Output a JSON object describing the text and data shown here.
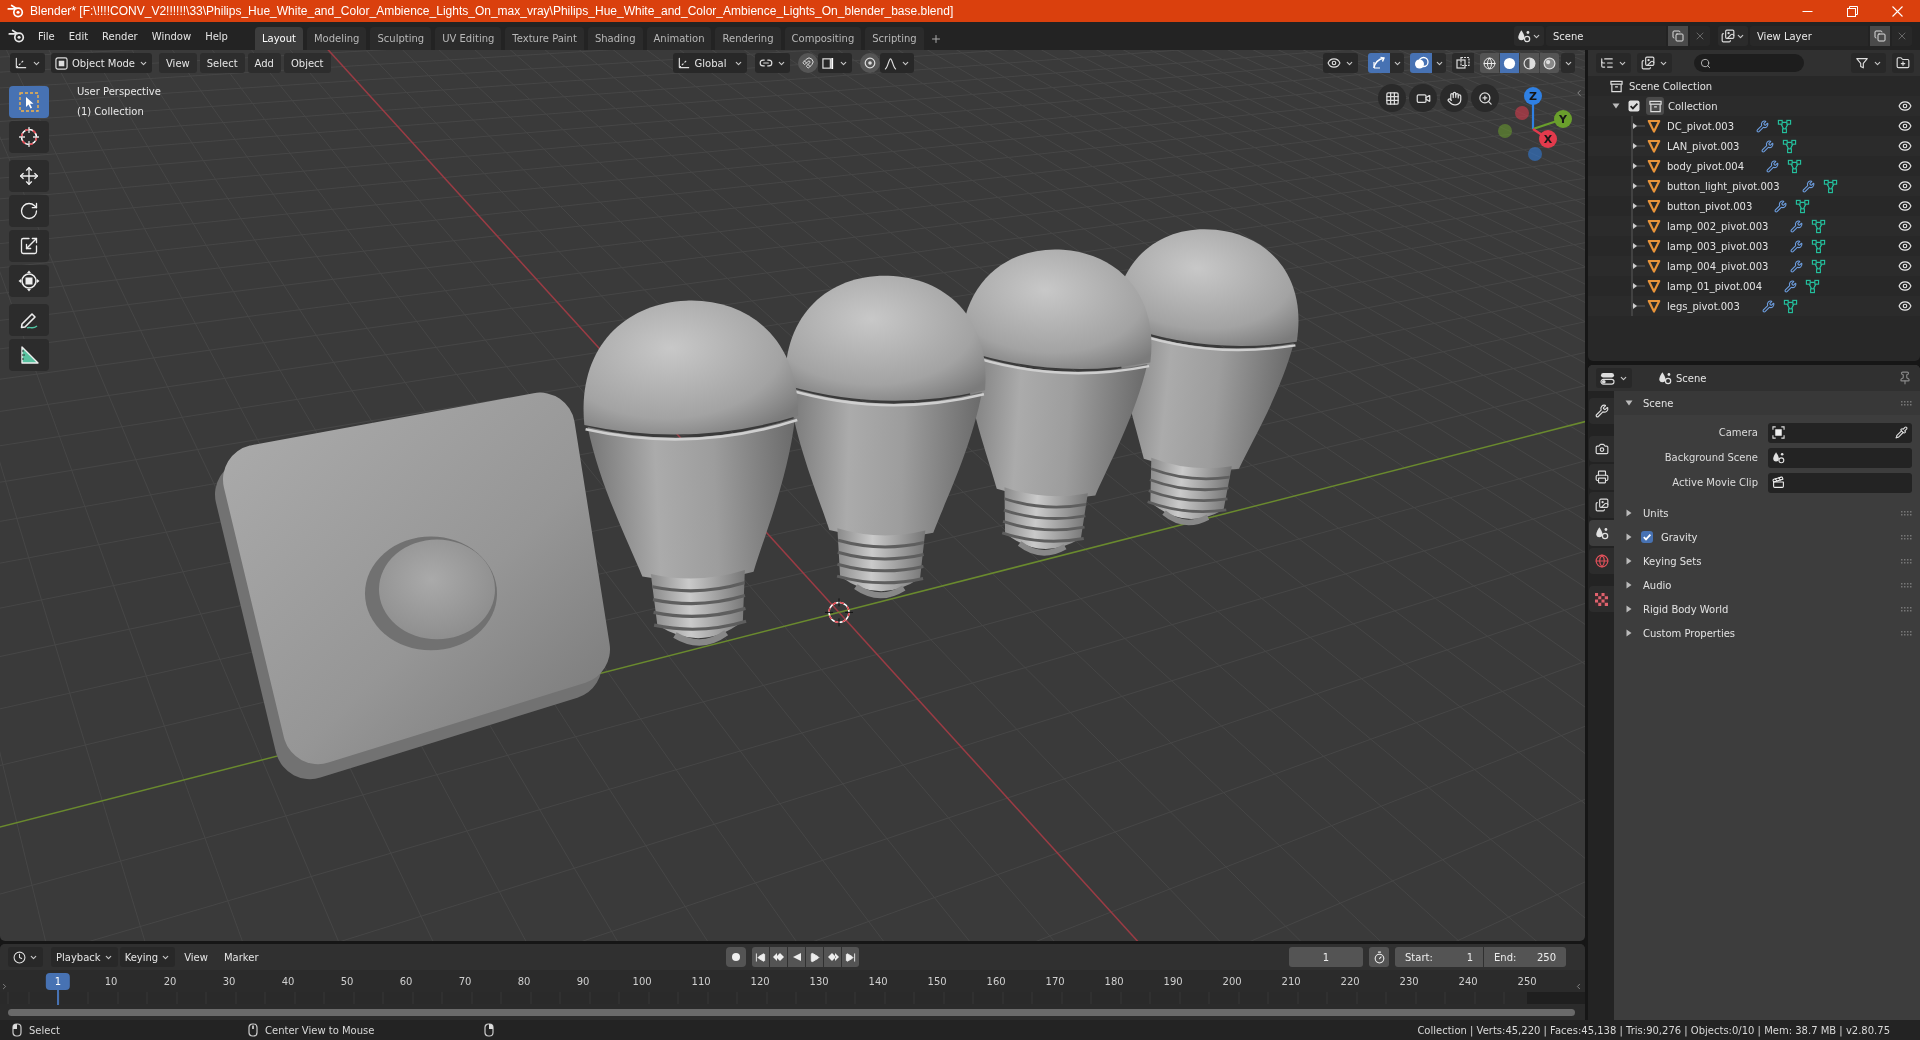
{
  "window": {
    "title": "Blender* [F:\\!!!!CONV_V2!!!!!!\\33\\Philips_Hue_White_and_Color_Ambience_Lights_On_max_vray\\Philips_Hue_White_and_Color_Ambience_Lights_On_blender_base.blend]"
  },
  "menu": [
    "File",
    "Edit",
    "Render",
    "Window",
    "Help"
  ],
  "workspaces": [
    {
      "label": "Layout",
      "selected": true
    },
    {
      "label": "Modeling",
      "selected": false
    },
    {
      "label": "Sculpting",
      "selected": false
    },
    {
      "label": "UV Editing",
      "selected": false
    },
    {
      "label": "Texture Paint",
      "selected": false
    },
    {
      "label": "Shading",
      "selected": false
    },
    {
      "label": "Animation",
      "selected": false
    },
    {
      "label": "Rendering",
      "selected": false
    },
    {
      "label": "Compositing",
      "selected": false
    },
    {
      "label": "Scripting",
      "selected": false
    }
  ],
  "scene": "Scene",
  "view_layer": "View Layer",
  "viewport": {
    "mode": "Object Mode",
    "menus": [
      "View",
      "Select",
      "Add",
      "Object"
    ],
    "orientation": "Global",
    "snap": false,
    "proportional_editing": false,
    "toggles": [
      {
        "kind": "gizmos",
        "on": true
      },
      {
        "kind": "overlays",
        "on": true
      },
      {
        "kind": "xray",
        "on": false
      }
    ],
    "shading": [
      {
        "kind": "wireframe",
        "selected": false
      },
      {
        "kind": "solid",
        "selected": true
      },
      {
        "kind": "material",
        "selected": false
      },
      {
        "kind": "rendered",
        "selected": false
      }
    ],
    "info": [
      "User Perspective",
      "(1) Collection"
    ],
    "tools": [
      [
        {
          "kind": "select_box",
          "selected": true
        },
        {
          "kind": "cursor",
          "selected": false
        }
      ],
      [
        {
          "kind": "move",
          "selected": false
        },
        {
          "kind": "rotate",
          "selected": false
        },
        {
          "kind": "scale",
          "selected": false
        },
        {
          "kind": "transform",
          "selected": false
        }
      ],
      [
        {
          "kind": "annotate",
          "selected": false
        },
        {
          "kind": "measure",
          "selected": false
        }
      ]
    ],
    "gizmo": [
      {
        "label": "Z",
        "color": "#2f80e3"
      },
      {
        "label": "Y",
        "color": "#6a9f2c"
      },
      {
        "label": "X",
        "color": "#e23a4c"
      }
    ]
  },
  "outliner": {
    "root": "Scene Collection",
    "items": [
      {
        "kind": "collection",
        "name": "Collection",
        "checked": true,
        "active": true,
        "expanded": true,
        "visible": true,
        "children": [
          {
            "kind": "mesh",
            "name": "DC_pivot.003",
            "expanded": false,
            "visible": true
          },
          {
            "kind": "mesh",
            "name": "LAN_pivot.003",
            "expanded": false,
            "visible": true
          },
          {
            "kind": "mesh",
            "name": "body_pivot.004",
            "expanded": false,
            "visible": true
          },
          {
            "kind": "mesh",
            "name": "button_light_pivot.003",
            "expanded": false,
            "visible": true
          },
          {
            "kind": "mesh",
            "name": "button_pivot.003",
            "expanded": false,
            "visible": true
          },
          {
            "kind": "mesh",
            "name": "lamp_002_pivot.003",
            "expanded": false,
            "visible": true
          },
          {
            "kind": "mesh",
            "name": "lamp_003_pivot.003",
            "expanded": false,
            "visible": true
          },
          {
            "kind": "mesh",
            "name": "lamp_004_pivot.003",
            "expanded": false,
            "visible": true
          },
          {
            "kind": "mesh",
            "name": "lamp_01_pivot.004",
            "expanded": false,
            "visible": true
          },
          {
            "kind": "mesh",
            "name": "legs_pivot.003",
            "expanded": false,
            "visible": true
          }
        ]
      }
    ]
  },
  "properties": {
    "context": "Scene",
    "tabs": [
      [
        {
          "kind": "tool",
          "selected": false
        }
      ],
      [
        {
          "kind": "render",
          "selected": false
        },
        {
          "kind": "output",
          "selected": false
        },
        {
          "kind": "view_layer",
          "selected": false
        },
        {
          "kind": "scene",
          "selected": true
        },
        {
          "kind": "world",
          "selected": false
        }
      ],
      [
        {
          "kind": "texture",
          "selected": false
        }
      ]
    ],
    "panels": [
      {
        "title": "Scene",
        "expanded": true,
        "fields": [
          {
            "label": "Camera",
            "kind": "camera"
          },
          {
            "label": "Background Scene",
            "kind": "scene"
          },
          {
            "label": "Active Movie Clip",
            "kind": "clip"
          }
        ]
      },
      {
        "title": "Units",
        "expanded": false
      },
      {
        "title": "Gravity",
        "expanded": false,
        "checked": true
      },
      {
        "title": "Keying Sets",
        "expanded": false
      },
      {
        "title": "Audio",
        "expanded": false
      },
      {
        "title": "Rigid Body World",
        "expanded": false
      },
      {
        "title": "Custom Properties",
        "expanded": false
      }
    ]
  },
  "timeline": {
    "menus": [
      {
        "label": "Playback",
        "kind": "dropdown"
      },
      {
        "label": "Keying",
        "kind": "dropdown"
      },
      {
        "label": "View",
        "kind": "menu"
      },
      {
        "label": "Marker",
        "kind": "menu"
      }
    ],
    "current_frame": "1",
    "start": {
      "label": "Start:",
      "value": "1"
    },
    "end": {
      "label": "End:",
      "value": "250"
    },
    "ruler": [
      {
        "label": "1",
        "selected": true
      },
      {
        "label": "10",
        "selected": false
      },
      {
        "label": "20",
        "selected": false
      },
      {
        "label": "30",
        "selected": false
      },
      {
        "label": "40",
        "selected": false
      },
      {
        "label": "50",
        "selected": false
      },
      {
        "label": "60",
        "selected": false
      },
      {
        "label": "70",
        "selected": false
      },
      {
        "label": "80",
        "selected": false
      },
      {
        "label": "90",
        "selected": false
      },
      {
        "label": "100",
        "selected": false
      },
      {
        "label": "110",
        "selected": false
      },
      {
        "label": "120",
        "selected": false
      },
      {
        "label": "130",
        "selected": false
      },
      {
        "label": "140",
        "selected": false
      },
      {
        "label": "150",
        "selected": false
      },
      {
        "label": "160",
        "selected": false
      },
      {
        "label": "170",
        "selected": false
      },
      {
        "label": "180",
        "selected": false
      },
      {
        "label": "190",
        "selected": false
      },
      {
        "label": "200",
        "selected": false
      },
      {
        "label": "210",
        "selected": false
      },
      {
        "label": "220",
        "selected": false
      },
      {
        "label": "230",
        "selected": false
      },
      {
        "label": "240",
        "selected": false
      },
      {
        "label": "250",
        "selected": false
      }
    ]
  },
  "status": {
    "hints": [
      {
        "kind": "left_mouse",
        "label": "Select"
      },
      {
        "kind": "middle_mouse",
        "label": "Center View to Mouse"
      },
      {
        "kind": "right_mouse"
      }
    ],
    "stats": "Collection | Verts:45,220 | Faces:45,138 | Tris:90,276 | Objects:0/10 | Mem: 38.7 MB | v2.80.75"
  }
}
